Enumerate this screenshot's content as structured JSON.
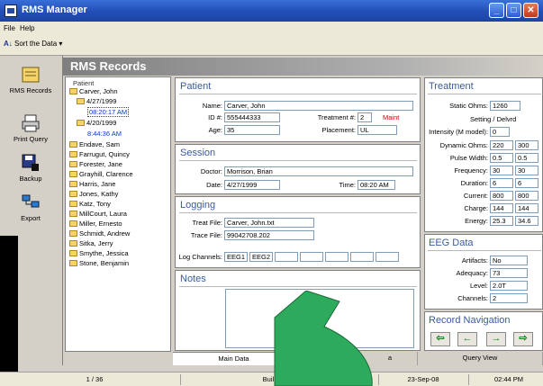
{
  "window": {
    "title": "RMS Manager"
  },
  "menu": [
    "File",
    "Help"
  ],
  "toolbar": {
    "sort_label": "Sort the Data",
    "sort_icon": "sort-az-icon"
  },
  "sidebar": {
    "items": [
      {
        "label": "RMS Records",
        "icon": "records-icon"
      },
      {
        "label": "Print Query",
        "icon": "printer-icon"
      },
      {
        "label": "Backup",
        "icon": "backup-icon"
      },
      {
        "label": "Export",
        "icon": "export-icon"
      }
    ]
  },
  "header": {
    "title": "RMS Records"
  },
  "tree": {
    "header": "Patient",
    "root": "Carver, John",
    "date1": "4/27/1999",
    "time1": "08:20:17 AM",
    "date2": "4/20/1999",
    "time2": "8:44:36 AM",
    "patients": [
      "Endave, Sam",
      "Farrugut, Quincy",
      "Forester, Jane",
      "Grayhill, Clarence",
      "Harris, Jane",
      "Jones, Kathy",
      "Katz, Tony",
      "MillCourt, Laura",
      "Miller, Ernesto",
      "Schmidt, Andrew",
      "Sitka, Jerry",
      "Smythe, Jessica",
      "Stone, Benjamin"
    ]
  },
  "patient": {
    "title": "Patient",
    "name_label": "Name:",
    "name": "Carver, John",
    "id_label": "ID #:",
    "id": "555444333",
    "age_label": "Age:",
    "age": "35",
    "treatment_label": "Treatment #:",
    "treatment": "2",
    "maint": "Maint",
    "placement_label": "Placement:",
    "placement": "UL"
  },
  "session": {
    "title": "Session",
    "doctor_label": "Doctor:",
    "doctor": "Morrison, Brian",
    "date_label": "Date:",
    "date": "4/27/1999",
    "time_label": "Time:",
    "time": "08:20 AM"
  },
  "logging": {
    "title": "Logging",
    "treat_label": "Treat File:",
    "treat_file": "Carver, John.txt",
    "trace_label": "Trace File:",
    "trace_file": "99042708.202",
    "channels_label": "Log Channels:",
    "ch1": "EEG1",
    "ch2": "EEG2"
  },
  "notes": {
    "title": "Notes"
  },
  "treatment": {
    "title": "Treatment",
    "static_label": "Static Ohms:",
    "static": "1260",
    "setting_label": "Setting / Delvrd",
    "intensity_label": "Intensity (M model):",
    "intensity": "0",
    "rows": [
      {
        "label": "Dynamic Ohms:",
        "a": "220",
        "b": "300"
      },
      {
        "label": "Pulse Width:",
        "a": "0.5",
        "b": "0.5"
      },
      {
        "label": "Frequency:",
        "a": "30",
        "b": "30"
      },
      {
        "label": "Duration:",
        "a": "6",
        "b": "6"
      },
      {
        "label": "Current:",
        "a": "800",
        "b": "800"
      },
      {
        "label": "Charge:",
        "a": "144",
        "b": "144"
      },
      {
        "label": "Energy:",
        "a": "25.3",
        "b": "34.6"
      }
    ]
  },
  "eeg": {
    "title": "EEG Data",
    "artifacts_label": "Artifacts:",
    "artifacts": "No",
    "adequacy_label": "Adequacy:",
    "adequacy": "73",
    "level_label": "Level:",
    "level": "2.0T",
    "channels_label": "Channels:",
    "channels": "2"
  },
  "nav": {
    "title": "Record Navigation"
  },
  "tabs": [
    "Main Data",
    "a",
    "Query View"
  ],
  "status": {
    "record": "1 / 36",
    "mode": "Build",
    "date": "23-Sep-08",
    "time": "02:44 PM"
  },
  "colors": {
    "overlay_arrow": "#2eaa5c",
    "accent": "#3a5aa0",
    "warning": "#d00000"
  }
}
